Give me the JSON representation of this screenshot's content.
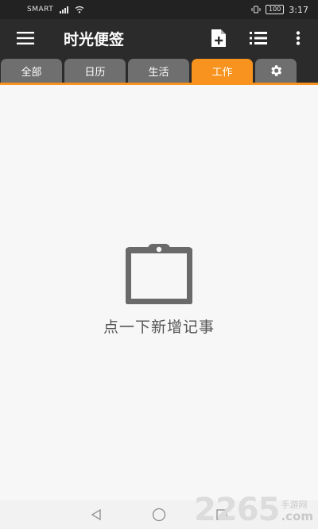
{
  "status_bar": {
    "carrier": "SMART",
    "battery": "100",
    "time": "3:17"
  },
  "app_bar": {
    "title": "时光便签",
    "icons": {
      "menu": "hamburger-menu-icon",
      "new_note": "new-note-icon",
      "list": "list-view-icon",
      "more": "more-vert-icon"
    }
  },
  "tabs": {
    "items": [
      {
        "label": "全部",
        "active": false
      },
      {
        "label": "日历",
        "active": false
      },
      {
        "label": "生活",
        "active": false
      },
      {
        "label": "工作",
        "active": true
      }
    ],
    "settings_icon": "gear-icon"
  },
  "empty_state": {
    "icon": "clipboard-icon",
    "text": "点一下新增记事"
  },
  "nav_bar": {
    "icons": [
      "back-triangle-icon",
      "home-circle-icon",
      "recents-square-icon"
    ]
  },
  "watermark": {
    "brand_number": "2265",
    "brand_cn": "手游网",
    "brand_domain": ".com"
  },
  "colors": {
    "accent": "#f7931e",
    "app_bar": "#2b2b2b",
    "tab_inactive": "#6f6f6f",
    "background": "#f7f7f7",
    "icon_gray": "#6a6a6a"
  }
}
